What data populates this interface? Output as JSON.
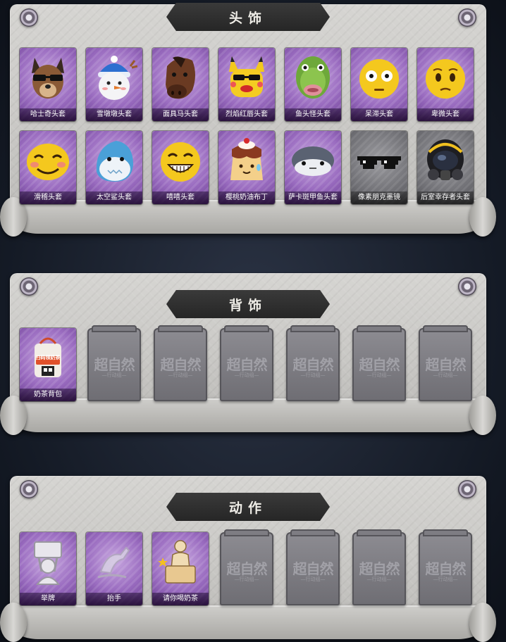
{
  "sections": [
    {
      "title": "头饰",
      "items": [
        {
          "label": "哈士奇头套",
          "icon": "husky-mask-icon"
        },
        {
          "label": "雪墩墩头套",
          "icon": "snowman-mask-icon"
        },
        {
          "label": "面具马头套",
          "icon": "horse-mask-icon"
        },
        {
          "label": "烈焰红唇头套",
          "icon": "pikachu-lips-mask-icon"
        },
        {
          "label": "鱼头怪头套",
          "icon": "fish-head-mask-icon"
        },
        {
          "label": "呆滞头套",
          "icon": "stunned-emoji-mask-icon"
        },
        {
          "label": "卑微头套",
          "icon": "humble-emoji-mask-icon"
        },
        {
          "label": "滑稽头套",
          "icon": "funny-emoji-mask-icon"
        },
        {
          "label": "太空鲨头套",
          "icon": "space-shark-mask-icon"
        },
        {
          "label": "嘻嘻头套",
          "icon": "grin-emoji-mask-icon"
        },
        {
          "label": "樱桃奶油布丁",
          "icon": "pudding-mask-icon"
        },
        {
          "label": "萨卡斑甲鱼头套",
          "icon": "sacabambaspis-mask-icon"
        },
        {
          "label": "像素朋克墨镜",
          "icon": "pixel-sunglasses-icon"
        },
        {
          "label": "后室幸存者头套",
          "icon": "gas-mask-helmet-icon"
        }
      ]
    },
    {
      "title": "背饰",
      "items": [
        {
          "label": "奶茶背包",
          "icon": "milk-tea-backpack-icon"
        }
      ],
      "locked_count": 6
    },
    {
      "title": "动作",
      "items": [
        {
          "label": "举牌",
          "icon": "hold-sign-action-icon"
        },
        {
          "label": "抬手",
          "icon": "raise-hand-action-icon"
        },
        {
          "label": "请你喝奶茶",
          "icon": "treat-milk-tea-action-icon"
        }
      ],
      "locked_count": 4
    }
  ],
  "locked_watermark": "超自然",
  "locked_watermark_sub": "—行动组—",
  "backpack_sign_text": "扫码领奶茶"
}
